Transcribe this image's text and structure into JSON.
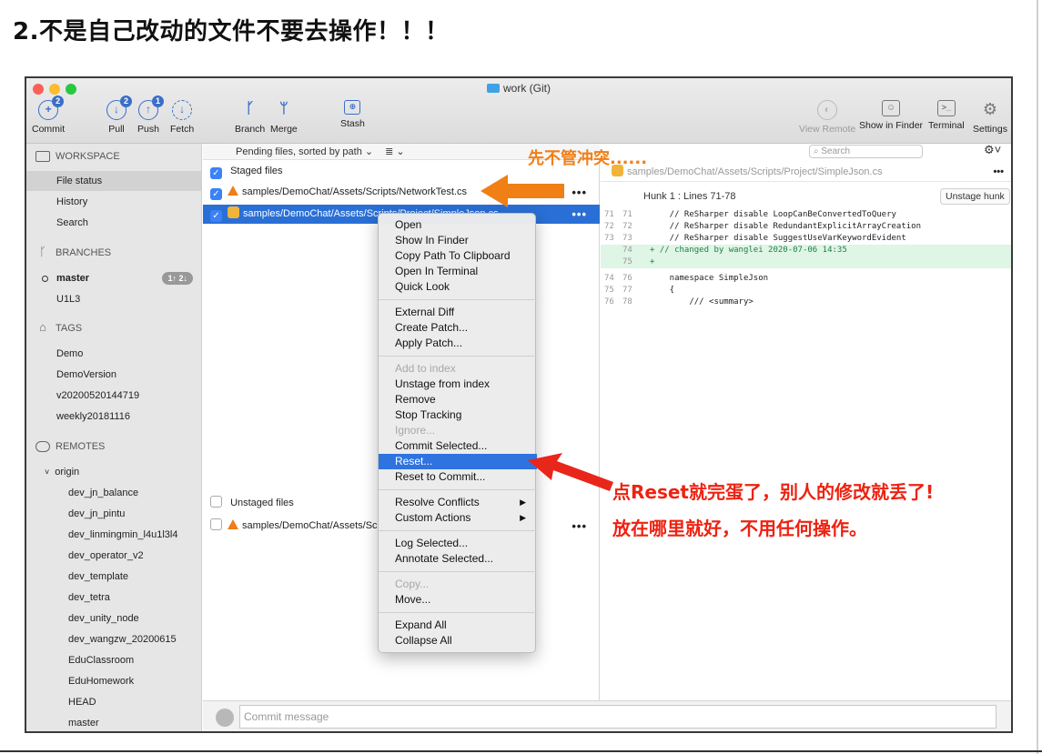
{
  "heading": "2.不是自己改动的文件不要去操作！！！",
  "window_title": "work (Git)",
  "toolbar": {
    "commit": {
      "label": "Commit",
      "badge": "2"
    },
    "pull": {
      "label": "Pull",
      "badge": "2"
    },
    "push": {
      "label": "Push",
      "badge": "1"
    },
    "fetch": {
      "label": "Fetch"
    },
    "branch": {
      "label": "Branch"
    },
    "merge": {
      "label": "Merge"
    },
    "stash": {
      "label": "Stash"
    },
    "view_remote": {
      "label": "View Remote"
    },
    "show_in_finder": {
      "label": "Show in Finder"
    },
    "terminal": {
      "label": "Terminal"
    },
    "settings": {
      "label": "Settings"
    }
  },
  "sidebar": {
    "workspace": {
      "title": "WORKSPACE",
      "items": [
        "File status",
        "History",
        "Search"
      ]
    },
    "branches": {
      "title": "BRANCHES",
      "items": [
        {
          "label": "master",
          "badge": "1↑ 2↓"
        },
        {
          "label": "U1L3"
        }
      ]
    },
    "tags": {
      "title": "TAGS",
      "items": [
        "Demo",
        "DemoVersion",
        "v20200520144719",
        "weekly20181116"
      ]
    },
    "remotes": {
      "title": "REMOTES",
      "origin": "origin",
      "items": [
        "dev_jn_balance",
        "dev_jn_pintu",
        "dev_linmingmin_l4u1l3l4",
        "dev_operator_v2",
        "dev_template",
        "dev_tetra",
        "dev_unity_node",
        "dev_wangzw_20200615",
        "EduClassroom",
        "EduHomework",
        "HEAD",
        "master"
      ]
    }
  },
  "file_list": {
    "sort_label": "Pending files, sorted by path ⌄",
    "view_toggle": "≣ ⌄",
    "staged_header": "Staged files",
    "staged": [
      "samples/DemoChat/Assets/Scripts/NetworkTest.cs",
      "samples/DemoChat/Assets/Scripts/Project/SimpleJson.cs"
    ],
    "unstaged_header": "Unstaged files",
    "unstaged": [
      "samples/DemoChat/Assets/Scri"
    ],
    "more": "•••"
  },
  "commit_placeholder": "Commit message",
  "search_placeholder": "Search",
  "diff": {
    "file": "samples/DemoChat/Assets/Scripts/Project/SimpleJson.cs",
    "hunk_title": "Hunk 1 : Lines 71-78",
    "unstage_hunk": "Unstage hunk",
    "lines": [
      {
        "old": "71",
        "new": "71",
        "text": "    // ReSharper disable LoopCanBeConvertedToQuery",
        "added": false
      },
      {
        "old": "72",
        "new": "72",
        "text": "    // ReSharper disable RedundantExplicitArrayCreation",
        "added": false
      },
      {
        "old": "73",
        "new": "73",
        "text": "    // ReSharper disable SuggestUseVarKeywordEvident",
        "added": false
      },
      {
        "old": "",
        "new": "74",
        "text": "+ // changed by wanglei 2020-07-06 14:35",
        "added": true
      },
      {
        "old": "",
        "new": "75",
        "text": "+",
        "added": true
      },
      {
        "old": "74",
        "new": "76",
        "text": "    namespace SimpleJson",
        "added": false
      },
      {
        "old": "75",
        "new": "77",
        "text": "    {",
        "added": false
      },
      {
        "old": "76",
        "new": "78",
        "text": "        /// <summary>",
        "added": false
      }
    ]
  },
  "context_menu": {
    "items": [
      {
        "label": "Open",
        "state": "normal"
      },
      {
        "label": "Show In Finder",
        "state": "normal"
      },
      {
        "label": "Copy Path To Clipboard",
        "state": "normal"
      },
      {
        "label": "Open In Terminal",
        "state": "normal"
      },
      {
        "label": "Quick Look",
        "state": "normal"
      },
      {
        "label": "External Diff",
        "state": "normal"
      },
      {
        "label": "Create Patch...",
        "state": "normal"
      },
      {
        "label": "Apply Patch...",
        "state": "normal"
      },
      {
        "label": "Add to index",
        "state": "disabled"
      },
      {
        "label": "Unstage from index",
        "state": "normal"
      },
      {
        "label": "Remove",
        "state": "normal"
      },
      {
        "label": "Stop Tracking",
        "state": "normal"
      },
      {
        "label": "Ignore...",
        "state": "disabled"
      },
      {
        "label": "Commit Selected...",
        "state": "normal"
      },
      {
        "label": "Reset...",
        "state": "highlighted"
      },
      {
        "label": "Reset to Commit...",
        "state": "normal"
      },
      {
        "label": "Resolve Conflicts",
        "state": "submenu"
      },
      {
        "label": "Custom Actions",
        "state": "submenu"
      },
      {
        "label": "Log Selected...",
        "state": "normal"
      },
      {
        "label": "Annotate Selected...",
        "state": "normal"
      },
      {
        "label": "Copy...",
        "state": "disabled"
      },
      {
        "label": "Move...",
        "state": "normal"
      },
      {
        "label": "Expand All",
        "state": "normal"
      },
      {
        "label": "Collapse All",
        "state": "normal"
      }
    ],
    "submenu_glyph": "▶"
  },
  "annotations": {
    "top": "先不管冲突......",
    "line1": "点Reset就完蛋了，别人的修改就丢了!",
    "line2": "放在哪里就好，不用任何操作。"
  },
  "colors": {
    "accent": "#2a6fd6",
    "annotation_orange": "#f07f16",
    "annotation_red": "#ee2211",
    "added_line_bg": "#dff5e6"
  }
}
